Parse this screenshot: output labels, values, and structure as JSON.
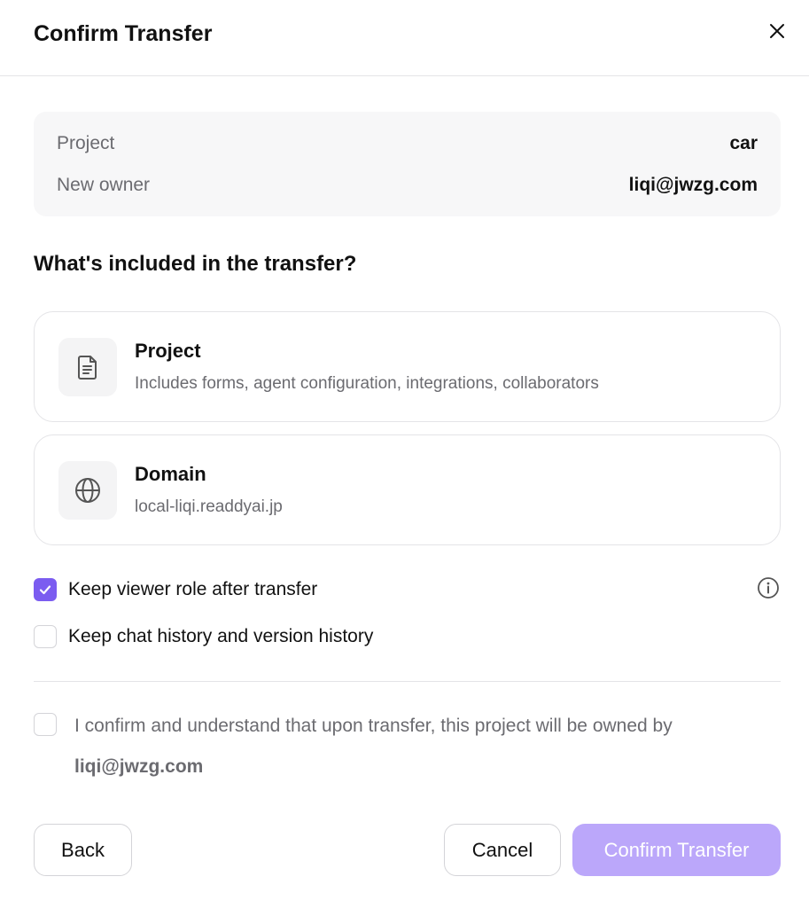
{
  "dialog": {
    "title": "Confirm Transfer"
  },
  "summary": {
    "project_label": "Project",
    "project_value": "car",
    "owner_label": "New owner",
    "owner_value": "liqi@jwzg.com"
  },
  "included": {
    "heading": "What's included in the transfer?",
    "items": [
      {
        "icon": "document-icon",
        "title": "Project",
        "description": "Includes forms, agent configuration, integrations, collaborators"
      },
      {
        "icon": "globe-icon",
        "title": "Domain",
        "description": "local-liqi.readdyai.jp"
      }
    ]
  },
  "options": [
    {
      "label": "Keep viewer role after transfer",
      "checked": true
    },
    {
      "label": "Keep chat history and version history",
      "checked": false
    }
  ],
  "confirmation": {
    "text": "I confirm and understand that upon transfer, this project will be owned by",
    "email": "liqi@jwzg.com",
    "checked": false
  },
  "footer": {
    "back_label": "Back",
    "cancel_label": "Cancel",
    "confirm_label": "Confirm Transfer"
  },
  "colors": {
    "accent": "#7b5cf0",
    "confirm_disabled": "#bba7fa",
    "muted_text": "#6b6b70",
    "border": "#e4e4e7"
  }
}
